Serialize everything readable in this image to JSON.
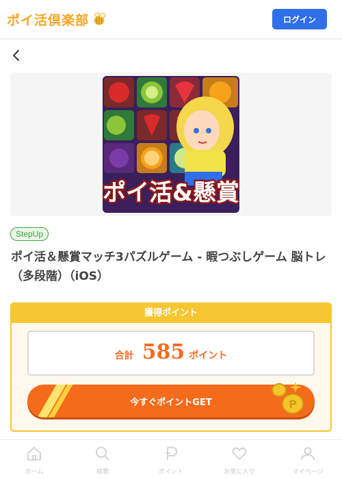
{
  "header": {
    "logo_text": "ポイ活倶楽部",
    "logo_icon": "bee-icon",
    "login_label": "ログイン",
    "login_color": "#2f6fe8"
  },
  "nav": {
    "back_icon": "chevron-left-icon"
  },
  "app": {
    "icon_label": "ポイ活&懸賞",
    "badge": "StepUp",
    "title": "ポイ活＆懸賞マッチ3パズルゲーム - 暇つぶしゲーム 脳トレ（多段階）（iOS）"
  },
  "points": {
    "header": "獲得ポイント",
    "total_label": "合計",
    "total_value": "585",
    "unit": "ポイント",
    "button_label": "今すぐポイントGET",
    "accent": "#f26c21",
    "border": "#f6c731"
  },
  "bottom_nav": [
    {
      "label": "ホーム",
      "icon": "home-icon"
    },
    {
      "label": "検索",
      "icon": "search-icon"
    },
    {
      "label": "ポイント",
      "icon": "point-icon"
    },
    {
      "label": "お気に入り",
      "icon": "heart-icon"
    },
    {
      "label": "マイページ",
      "icon": "user-icon"
    }
  ]
}
